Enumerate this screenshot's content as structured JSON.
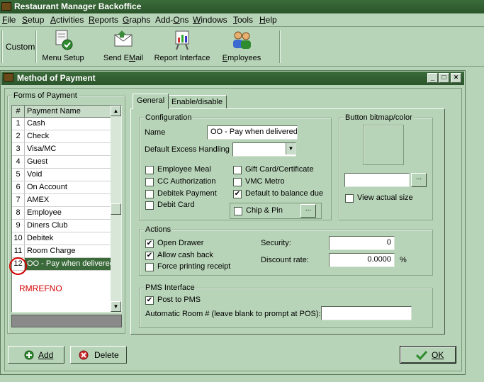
{
  "app": {
    "title": "Restaurant Manager Backoffice"
  },
  "menu": [
    {
      "pre": "",
      "ul": "F",
      "post": "ile"
    },
    {
      "pre": "",
      "ul": "S",
      "post": "etup"
    },
    {
      "pre": "",
      "ul": "A",
      "post": "ctivities"
    },
    {
      "pre": "",
      "ul": "R",
      "post": "eports"
    },
    {
      "pre": "",
      "ul": "G",
      "post": "raphs"
    },
    {
      "pre": "Add-",
      "ul": "O",
      "post": "ns"
    },
    {
      "pre": "",
      "ul": "W",
      "post": "indows"
    },
    {
      "pre": "",
      "ul": "T",
      "post": "ools"
    },
    {
      "pre": "",
      "ul": "H",
      "post": "elp"
    }
  ],
  "toolbar": {
    "custom_label": "Custom",
    "buttons": [
      {
        "label": "Menu Setup",
        "icon": "menu-setup-icon"
      },
      {
        "label": "Send EMail",
        "icon": "email-icon"
      },
      {
        "label": "Report Interface",
        "icon": "report-interface-icon"
      },
      {
        "label": "Employees",
        "icon": "employees-icon"
      }
    ]
  },
  "window": {
    "title": "Method of Payment",
    "buttons": [
      "_",
      "□",
      "×"
    ]
  },
  "forms_panel": {
    "label": "Forms of Payment",
    "col_num": "#",
    "col_name": "Payment Name",
    "rows": [
      {
        "num": "1",
        "name": "Cash"
      },
      {
        "num": "2",
        "name": "Check"
      },
      {
        "num": "3",
        "name": "Visa/MC"
      },
      {
        "num": "4",
        "name": "Guest"
      },
      {
        "num": "5",
        "name": "Void"
      },
      {
        "num": "6",
        "name": "On Account"
      },
      {
        "num": "7",
        "name": "AMEX"
      },
      {
        "num": "8",
        "name": "Employee"
      },
      {
        "num": "9",
        "name": "Diners Club"
      },
      {
        "num": "10",
        "name": "Debitek"
      },
      {
        "num": "11",
        "name": "Room Charge"
      },
      {
        "num": "12",
        "name": "OO - Pay when delivered"
      }
    ],
    "selected_index": 11,
    "annotation": "RMREFNO"
  },
  "tabs": [
    {
      "label": "General",
      "active": true
    },
    {
      "label": "Enable/disable",
      "active": false
    }
  ],
  "configuration": {
    "label": "Configuration",
    "name_label": "Name",
    "name_value": "OO - Pay when delivered",
    "excess_label": "Default Excess Handling",
    "excess_value": "",
    "checks_left": [
      {
        "label": "Employee Meal",
        "checked": false
      },
      {
        "label": "CC Authorization",
        "checked": false
      },
      {
        "label": "Debitek Payment",
        "checked": false
      },
      {
        "label": "Debit Card",
        "checked": false
      }
    ],
    "checks_right": [
      {
        "label": "Gift Card/Certificate",
        "checked": false
      },
      {
        "label": "VMC Metro",
        "checked": false
      },
      {
        "label": "Default to balance due",
        "checked": true
      }
    ],
    "chip_pin": {
      "label": "Chip & Pin",
      "checked": false,
      "button": "..."
    }
  },
  "bitmap": {
    "label": "Button bitmap/color",
    "path_value": "",
    "browse": "...",
    "view_actual_label": "View actual size",
    "view_actual_checked": false
  },
  "actions": {
    "label": "Actions",
    "checks": [
      {
        "label": "Open Drawer",
        "checked": true
      },
      {
        "label": "Allow cash back",
        "checked": true
      },
      {
        "label": "Force printing receipt",
        "checked": false
      }
    ],
    "security_label": "Security:",
    "security_value": "0",
    "discount_label": "Discount rate:",
    "discount_value": "0.0000",
    "percent": "%"
  },
  "pms": {
    "label": "PMS Interface",
    "post_label": "Post to PMS",
    "post_checked": true,
    "room_label": "Automatic Room # (leave blank to prompt at POS):",
    "room_value": ""
  },
  "footer": {
    "add_label": "Add",
    "delete_label": "Delete",
    "ok_label": "OK"
  },
  "colors": {
    "bg": "#b8d4b8",
    "titlebar": "#2b552b",
    "selection": "#3a6a3a",
    "annotation": "#d40000"
  }
}
